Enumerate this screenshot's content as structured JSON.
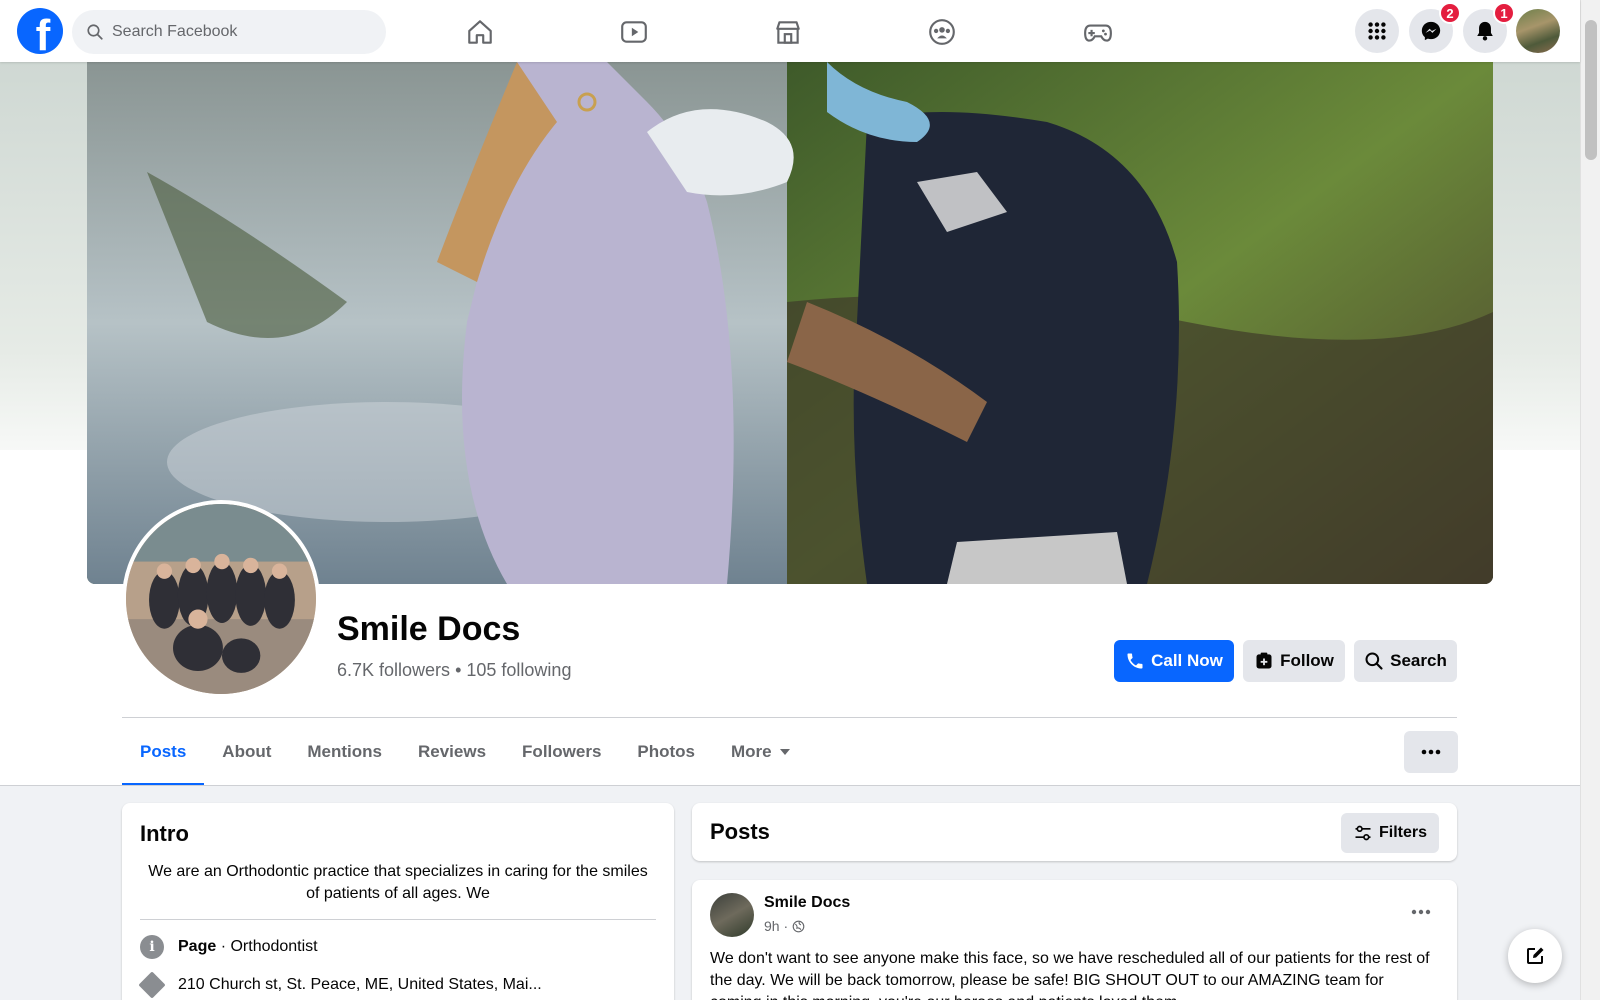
{
  "topnav": {
    "logo_letter": "f",
    "search_placeholder": "Search Facebook",
    "nav_icons": [
      "home-icon",
      "video-icon",
      "marketplace-icon",
      "groups-icon",
      "gaming-icon"
    ],
    "menu_icon": "grid-menu-icon",
    "messenger_badge": "2",
    "notifications_badge": "1"
  },
  "profile": {
    "name": "Smile Docs",
    "followers": "6.7K followers",
    "separator": " • ",
    "following": "105 following",
    "call_label": "Call Now",
    "follow_label": "Follow",
    "search_label": "Search"
  },
  "tabs": [
    {
      "label": "Posts",
      "active": true
    },
    {
      "label": "About"
    },
    {
      "label": "Mentions"
    },
    {
      "label": "Reviews"
    },
    {
      "label": "Followers"
    },
    {
      "label": "Photos"
    },
    {
      "label": "More"
    }
  ],
  "intro": {
    "title": "Intro",
    "description": "We are an Orthodontic practice that specializes in caring for the smiles of patients of all ages. We",
    "category_bold": "Page",
    "category_rest": " · Orthodontist",
    "address": "210 Church st, St. Peace, ME, United States, Mai..."
  },
  "posts": {
    "title": "Posts",
    "filters_label": "Filters",
    "post": {
      "author": "Smile Docs",
      "time": "9h ·",
      "text": "We don't want to see anyone make this face, so we have rescheduled all of our patients for the rest of the day.  We will be back tomorrow, please be safe!  BIG SHOUT OUT to our AMAZING team for coming in this morning, you're our heroes and patients loved them"
    }
  },
  "colors": {
    "brand": "#0866ff",
    "badge": "#e41e3f",
    "secondary_text": "#65676b"
  }
}
